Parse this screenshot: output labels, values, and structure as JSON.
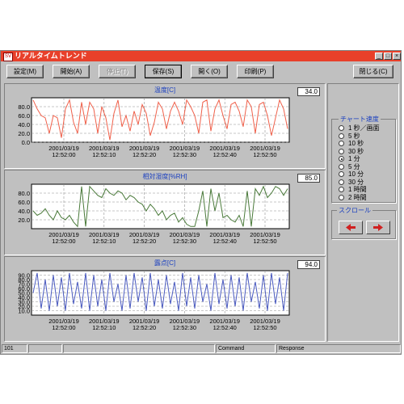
{
  "window": {
    "title": "リアルタイムトレンド",
    "icon_text": "SV"
  },
  "toolbar": {
    "buttons": [
      {
        "label": "設定(M)",
        "enabled": true
      },
      {
        "label": "開始(A)",
        "enabled": true
      },
      {
        "label": "停止(T)",
        "enabled": false
      },
      {
        "label": "保存(S)",
        "enabled": true
      },
      {
        "label": "開く(O)",
        "enabled": true
      },
      {
        "label": "印刷(P)",
        "enabled": true
      }
    ],
    "close_label": "閉じる(C)"
  },
  "charts": [
    {
      "title": "温度[C]",
      "value": "34.0"
    },
    {
      "title": "相対湿度[%RH]",
      "value": "85.0"
    },
    {
      "title": "露点[C]",
      "value": "94.0"
    }
  ],
  "time_ticks": [
    {
      "date": "2001/03/19",
      "time": "12:52:00"
    },
    {
      "date": "2001/03/19",
      "time": "12:52:10"
    },
    {
      "date": "2001/03/19",
      "time": "12:52:20"
    },
    {
      "date": "2001/03/19",
      "time": "12:52:30"
    },
    {
      "date": "2001/03/19",
      "time": "12:52:40"
    },
    {
      "date": "2001/03/19",
      "time": "12:52:50"
    }
  ],
  "chart_speed": {
    "label": "チャート速度",
    "options": [
      "1 秒／画面",
      "5 秒",
      "10 秒",
      "30 秒",
      "1 分",
      "5 分",
      "10 分",
      "30 分",
      "1 時間",
      "2 時間"
    ],
    "selected_index": 4
  },
  "scroll": {
    "label": "スクロール",
    "left_icon": "arrow-left-icon",
    "right_icon": "arrow-right-icon"
  },
  "status": {
    "cells": [
      "101",
      "",
      "",
      "Command",
      "Response"
    ]
  },
  "colors": {
    "title_bar": "#e8402a",
    "series_temp": "#f0604a",
    "series_humidity": "#4a7a3a",
    "series_dew": "#4a5ac0",
    "chart_title_text": "#1a3fbf"
  },
  "chart_data": [
    {
      "type": "line",
      "title": "温度[C]",
      "ylim": [
        0,
        100
      ],
      "yticks": [
        "0.0",
        "20.0",
        "40.0",
        "60.0",
        "80.0"
      ],
      "x": [
        "12:52:00",
        "12:52:10",
        "12:52:20",
        "12:52:30",
        "12:52:40",
        "12:52:50"
      ],
      "grid": true,
      "series": [
        {
          "values": [
            95,
            75,
            60,
            55,
            20,
            60,
            55,
            10,
            75,
            95,
            45,
            20,
            90,
            40,
            90,
            75,
            20,
            80,
            55,
            5,
            65,
            95,
            35,
            60,
            25,
            70,
            40,
            85,
            65,
            15,
            45,
            90,
            75,
            30,
            70,
            90,
            70,
            40,
            95,
            80,
            60,
            20,
            90,
            95,
            25,
            75,
            95,
            60,
            30,
            85,
            90,
            70,
            35,
            95,
            80,
            20,
            85,
            90,
            60,
            15,
            55,
            95,
            75,
            30
          ]
        }
      ]
    },
    {
      "type": "line",
      "title": "相対湿度[%RH]",
      "ylim": [
        0,
        100
      ],
      "yticks": [
        "20.0",
        "40.0",
        "60.0",
        "80.0"
      ],
      "x": [
        "12:52:00",
        "12:52:10",
        "12:52:20",
        "12:52:30",
        "12:52:40",
        "12:52:50"
      ],
      "grid": true,
      "series": [
        {
          "values": [
            40,
            30,
            35,
            45,
            30,
            20,
            40,
            25,
            20,
            30,
            15,
            5,
            95,
            5,
            95,
            85,
            75,
            70,
            90,
            80,
            75,
            85,
            80,
            65,
            75,
            70,
            60,
            55,
            40,
            55,
            45,
            30,
            40,
            20,
            30,
            35,
            15,
            25,
            10,
            5,
            5,
            40,
            85,
            5,
            90,
            40,
            80,
            25,
            30,
            20,
            15,
            30,
            5,
            85,
            5,
            90,
            75,
            95,
            70,
            80,
            95,
            90,
            75,
            90
          ]
        }
      ]
    },
    {
      "type": "line",
      "title": "露点[C]",
      "ylim": [
        0,
        100
      ],
      "yticks": [
        "10.0",
        "20.0",
        "30.0",
        "40.0",
        "50.0",
        "60.0",
        "70.0",
        "80.0",
        "90.0"
      ],
      "x": [
        "12:52:00",
        "12:52:10",
        "12:52:20",
        "12:52:30",
        "12:52:40",
        "12:52:50"
      ],
      "grid": true,
      "series": [
        {
          "values": [
            50,
            95,
            15,
            80,
            10,
            90,
            20,
            85,
            10,
            95,
            25,
            75,
            15,
            95,
            10,
            90,
            20,
            80,
            10,
            95,
            30,
            70,
            10,
            90,
            15,
            95,
            30,
            85,
            10,
            95,
            20,
            80,
            15,
            90,
            25,
            75,
            10,
            95,
            20,
            85,
            15,
            90,
            30,
            70,
            10,
            95,
            25,
            80,
            15,
            90,
            20,
            85,
            10,
            95,
            30,
            75,
            15,
            90,
            10,
            95,
            25,
            85,
            10,
            95
          ]
        }
      ]
    }
  ]
}
